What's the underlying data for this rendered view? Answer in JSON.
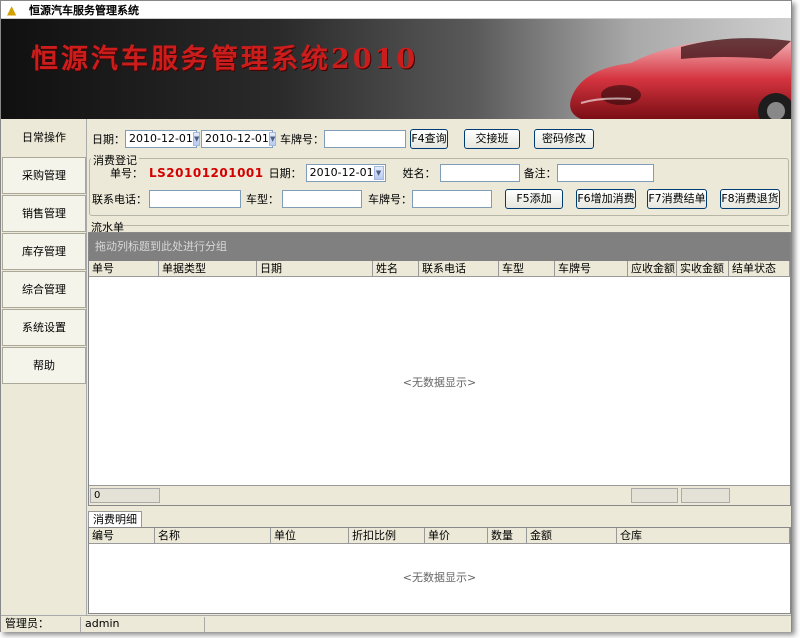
{
  "window": {
    "title": "恒源汽车服务管理系统"
  },
  "banner": {
    "title": "恒源汽车服务管理系统2010"
  },
  "sidebar": {
    "items": [
      {
        "label": "日常操作"
      },
      {
        "label": "采购管理"
      },
      {
        "label": "销售管理"
      },
      {
        "label": "库存管理"
      },
      {
        "label": "综合管理"
      },
      {
        "label": "系统设置"
      },
      {
        "label": "帮助"
      }
    ]
  },
  "query": {
    "date_label": "日期：",
    "date_from": "2010-12-01",
    "date_to": "2010-12-01",
    "plate_label": "车牌号：",
    "plate_value": "",
    "query_button": "F4查询",
    "shift_button": "交接班",
    "password_button": "密码修改"
  },
  "register": {
    "group_title": "消费登记",
    "order_label": "单号：",
    "order_no": "LS20101201001",
    "date_label": "日期：",
    "date_value": "2010-12-01",
    "name_label": "姓名：",
    "name_value": "",
    "remark_label": "备注：",
    "remark_value": "",
    "phone_label": "联系电话：",
    "phone_value": "",
    "model_label": "车型：",
    "model_value": "",
    "plate_label": "车牌号：",
    "plate_value": "",
    "add_button": "F5添加",
    "add_consume_button": "F6增加消费",
    "settle_button": "F7消费结单",
    "refund_button": "F8消费退货"
  },
  "ledger": {
    "group_title": "流水单",
    "group_hint": "拖动列标题到此处进行分组",
    "columns": [
      "单号",
      "单据类型",
      "日期",
      "姓名",
      "联系电话",
      "车型",
      "车牌号",
      "应收金额",
      "实收金额",
      "结单状态"
    ],
    "empty_text": "<无数据显示>",
    "footer_count": "0"
  },
  "detail": {
    "tab_label": "消费明细",
    "columns": [
      "编号",
      "名称",
      "单位",
      "折扣比例",
      "单价",
      "数量",
      "金额",
      "仓库"
    ],
    "empty_text": "<无数据显示>"
  },
  "status": {
    "operator_label": "管理员：",
    "operator_value": "admin"
  },
  "colors": {
    "accent_red": "#d40000",
    "banner_title": "#cc1d1d",
    "group_header": "#808080"
  }
}
